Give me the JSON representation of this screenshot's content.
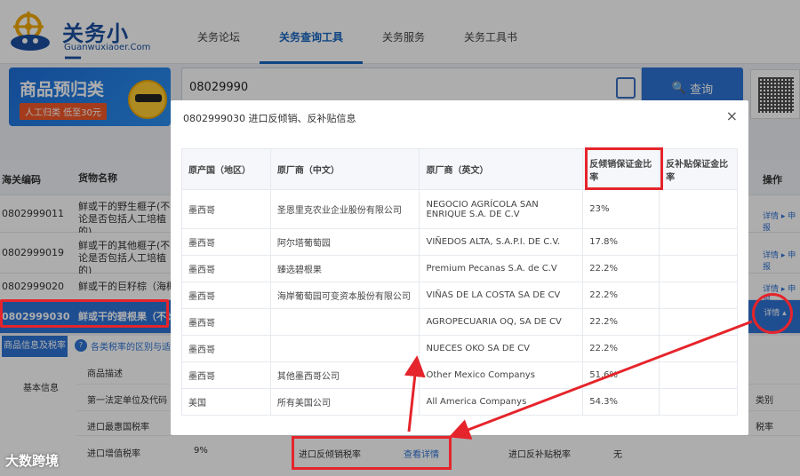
{
  "header": {
    "logo_text": "关务小二",
    "logo_sub": "Guanwuxiaoer.Com",
    "nav": [
      "关务论坛",
      "关务查询工具",
      "关务服务",
      "关务工具书"
    ]
  },
  "banner": {
    "title": "商品预归类",
    "tag": "人工归类  低至30元"
  },
  "search": {
    "value": "08029990",
    "button": "查询"
  },
  "table": {
    "headers": {
      "code": "海关编码",
      "name": "货物名称",
      "op": "操作"
    },
    "rows": [
      {
        "code": "0802999011",
        "name": "鲜或干的野生榧子(不论是否包括人工培植的)",
        "op": "详情 ▸ 申报"
      },
      {
        "code": "0802999019",
        "name": "鲜或干的其他榧子(不论是否包括人工培植的)",
        "op": "详情 ▸ 申报"
      },
      {
        "code": "0802999020",
        "name": "鲜或干的巨籽棕（海椰子）",
        "op": "详情 ▸ 申报"
      },
      {
        "code": "0802999030",
        "name": "鲜或干的碧根果（不论是否",
        "op": "详情 ▴"
      }
    ]
  },
  "tabs": {
    "a": "商品信息及税率",
    "b": "各类税率的区别与适"
  },
  "info": {
    "section": "基本信息",
    "labels": [
      "商品描述",
      "第一法定单位及代码",
      "进口最惠国税率",
      "进口增值税率"
    ],
    "vat": "9%",
    "right1": "类别",
    "right2": "税率"
  },
  "bottom": {
    "antidumping": "进口反倾销税率",
    "detail_link": "查看详情",
    "subsidy": "进口反补贴税率",
    "subsidy_val": "无"
  },
  "modal": {
    "title": "0802999030 进口反倾销、反补贴信息",
    "close": "×",
    "columns": [
      "原产国（地区）",
      "原厂商（中文）",
      "原厂商（英文）",
      "反倾销保证金比率",
      "反补贴保证金比率"
    ],
    "rows": [
      [
        "墨西哥",
        "圣恩里克农业企业股份有限公司",
        "NEGOCIO AGRÍCOLA SAN ENRIQUE S.A. DE C.V",
        "23%",
        ""
      ],
      [
        "墨西哥",
        "阿尔塔葡萄园",
        "VIÑEDOS ALTA, S.A.P.I. DE C.V.",
        "17.8%",
        ""
      ],
      [
        "墨西哥",
        "臻选碧根果",
        "Premium Pecanas S.A. de C.V",
        "22.2%",
        ""
      ],
      [
        "墨西哥",
        "海岸葡萄园可变资本股份有限公司",
        "VIÑAS DE LA COSTA SA DE CV",
        "22.2%",
        ""
      ],
      [
        "墨西哥",
        "",
        "AGROPECUARIA OQ, SA DE CV",
        "22.2%",
        ""
      ],
      [
        "墨西哥",
        "",
        "NUECES OKO SA DE CV",
        "22.2%",
        ""
      ],
      [
        "墨西哥",
        "其他墨西哥公司",
        "Other Mexico Companys",
        "51.6%",
        ""
      ],
      [
        "美国",
        "所有美国公司",
        "All America Companys",
        "54.3%",
        ""
      ]
    ]
  },
  "watermark": "大数跨境"
}
